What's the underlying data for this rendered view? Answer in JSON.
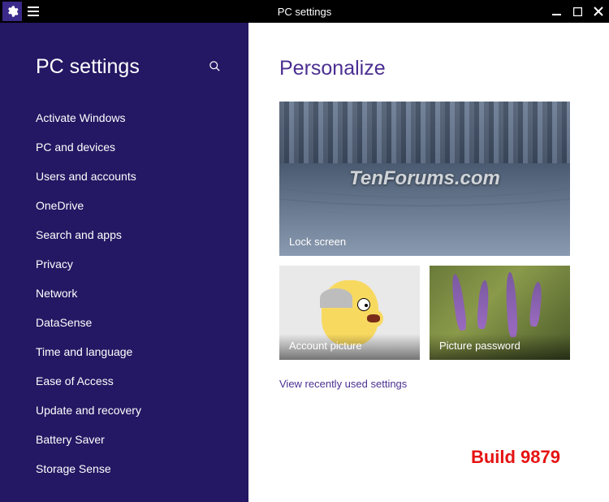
{
  "titlebar": {
    "title": "PC settings"
  },
  "sidebar": {
    "title": "PC settings",
    "items": [
      "Activate Windows",
      "PC and devices",
      "Users and accounts",
      "OneDrive",
      "Search and apps",
      "Privacy",
      "Network",
      "DataSense",
      "Time and language",
      "Ease of Access",
      "Update and recovery",
      "Battery Saver",
      "Storage Sense"
    ]
  },
  "main": {
    "title": "Personalize",
    "watermark": "TenForums.com",
    "tile_lock_screen": "Lock screen",
    "tile_account_picture": "Account picture",
    "tile_picture_password": "Picture password",
    "recent_link": "View recently used settings",
    "build_label": "Build 9879"
  }
}
